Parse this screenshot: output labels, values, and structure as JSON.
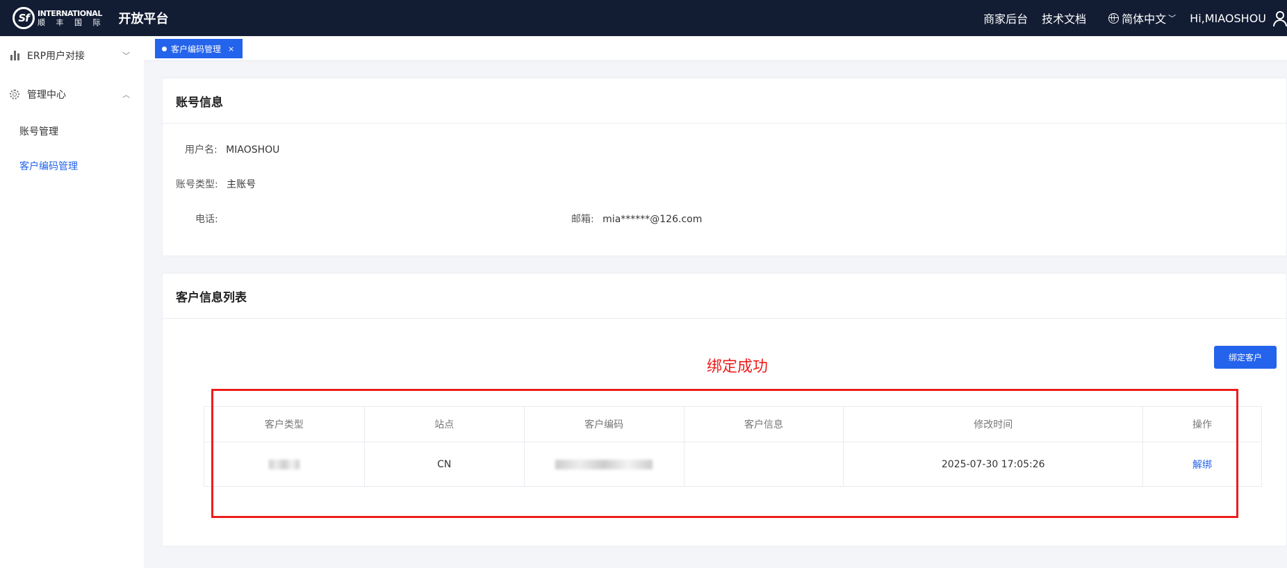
{
  "header": {
    "logo_mark": "Sf",
    "logo_line1": "INTERNATIONAL",
    "logo_line2": "顺 丰 国 际",
    "platform_title": "开放平台",
    "nav": [
      "商家后台",
      "技术文档"
    ],
    "language": "简体中文",
    "greeting": "Hi,MIAOSHOU"
  },
  "sidebar": {
    "groups": [
      {
        "label": "ERP用户对接",
        "icon": "bar-chart-icon",
        "expanded": false
      },
      {
        "label": "管理中心",
        "icon": "gear-icon",
        "expanded": true
      }
    ],
    "submenu": [
      {
        "label": "账号管理",
        "active": false
      },
      {
        "label": "客户编码管理",
        "active": true
      }
    ]
  },
  "tabs": [
    {
      "label": "客户编码管理",
      "close": "×"
    }
  ],
  "account": {
    "title": "账号信息",
    "username_label": "用户名:",
    "username": "MIAOSHOU",
    "type_label": "账号类型:",
    "type": "主账号",
    "phone_label": "电话:",
    "phone": "",
    "email_label": "邮箱:",
    "email": "mia******@126.com"
  },
  "customers": {
    "title": "客户信息列表",
    "bind_button": "绑定客户",
    "success_message": "绑定成功",
    "columns": [
      "客户类型",
      "站点",
      "客户编码",
      "客户信息",
      "修改时间",
      "操作"
    ],
    "rows": [
      {
        "type": "",
        "site": "CN",
        "code": "",
        "info": "",
        "modified": "2025-07-30 17:05:26",
        "action": "解绑"
      }
    ]
  },
  "colors": {
    "topbar": "#121c33",
    "accent": "#2463eb",
    "highlight": "#ee1c1c"
  }
}
